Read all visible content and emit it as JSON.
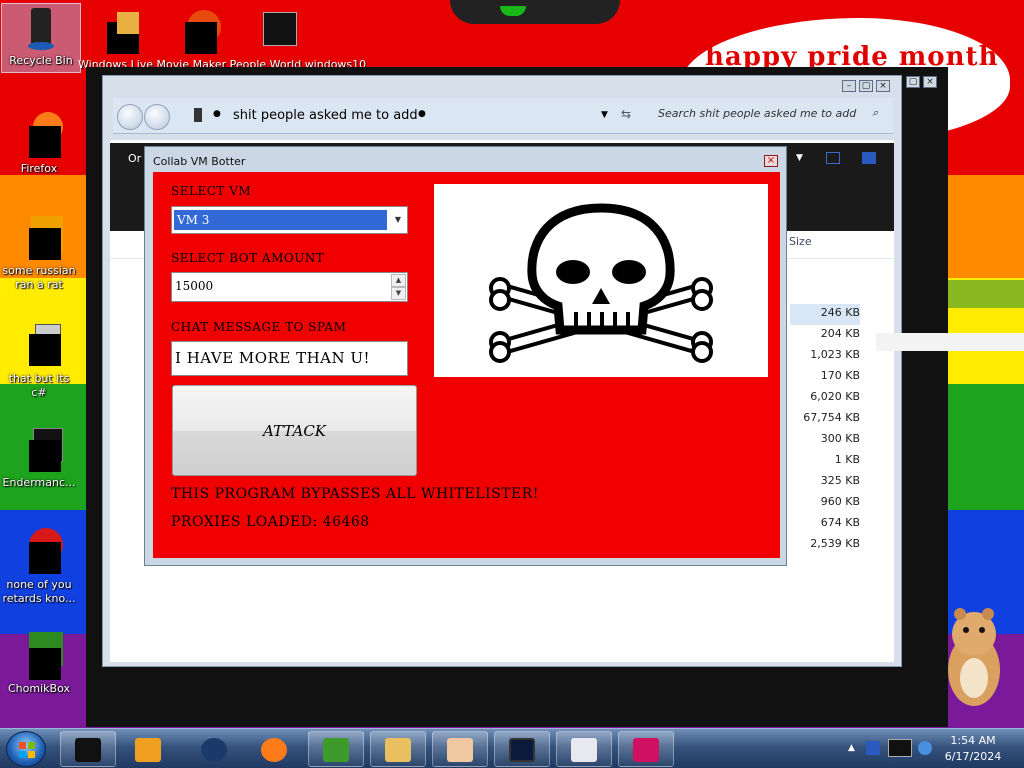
{
  "desktop": {
    "icons": [
      {
        "label": "Recycle Bin",
        "selected": true
      },
      {
        "label": "Windows Live Movie Maker"
      },
      {
        "label": "People World"
      },
      {
        "label": "windows10"
      },
      {
        "label": "Firefox"
      },
      {
        "label": "some russian ran a rat"
      },
      {
        "label": "that but its c#"
      },
      {
        "label": "Endermanc..."
      },
      {
        "label": "none of you retards kno..."
      },
      {
        "label": "ChomikBox"
      }
    ],
    "balloon_text": "happy pride month"
  },
  "explorer": {
    "address": "shit people asked me to add",
    "search_placeholder": "Search shit people asked me to add",
    "menu_initial": "Or",
    "size_header": "Size",
    "file_sizes": [
      "246 KB",
      "204 KB",
      "1,023 KB",
      "170 KB",
      "6,020 KB",
      "67,754 KB",
      "300 KB",
      "1 KB",
      "325 KB",
      "960 KB",
      "674 KB",
      "2,539 KB"
    ]
  },
  "dialog": {
    "title": "Collab VM Botter",
    "select_vm_label": "SELECT VM",
    "select_vm_value": "VM 3",
    "bot_amount_label": "SELECT BOT AMOUNT",
    "bot_amount_value": "15000",
    "chat_label": "CHAT MESSAGE TO SPAM",
    "chat_value": "I HAVE MORE THAN U!",
    "attack_label": "ATTACK",
    "bypass_text": "THIS PROGRAM BYPASSES ALL WHITELISTER!",
    "proxies_text": "PROXIES LOADED: 46468"
  },
  "taskbar": {
    "time": "1:54 AM",
    "date": "6/17/2024"
  }
}
